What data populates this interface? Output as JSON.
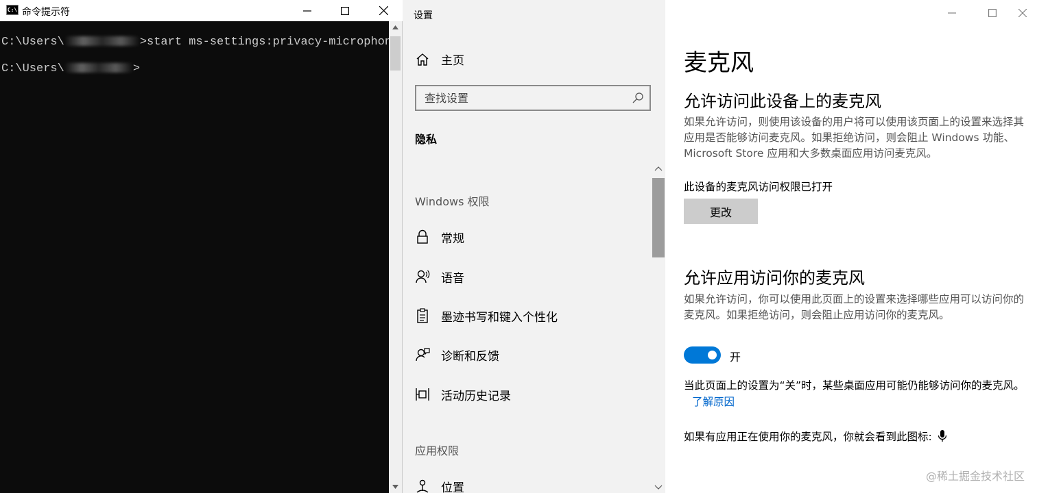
{
  "cmd": {
    "title": "命令提示符",
    "icon": "C:\\",
    "line1_prefix": "C:\\Users\\",
    "line1_suffix": ">start ms-settings:privacy-microphone",
    "line2_prefix": "C:\\Users\\",
    "line2_suffix": ">"
  },
  "settings": {
    "title": "设置",
    "home_label": "主页",
    "search_placeholder": "查找设置",
    "section": "隐私",
    "group_windows": "Windows 权限",
    "group_apps": "应用权限",
    "nav_items": [
      {
        "label": "常规",
        "icon": "lock-icon"
      },
      {
        "label": "语音",
        "icon": "speech-icon"
      },
      {
        "label": "墨迹书写和键入个性化",
        "icon": "clipboard-icon"
      },
      {
        "label": "诊断和反馈",
        "icon": "feedback-icon"
      },
      {
        "label": "活动历史记录",
        "icon": "timeline-icon"
      },
      {
        "label": "位置",
        "icon": "location-icon"
      }
    ]
  },
  "content": {
    "page_title": "麦克风",
    "device_heading": "允许访问此设备上的麦克风",
    "device_desc": "如果允许访问，则使用该设备的用户将可以使用该页面上的设置来选择其应用是否能够访问麦克风。如果拒绝访问，则会阻止 Windows 功能、Microsoft Store 应用和大多数桌面应用访问麦克风。",
    "device_status": "此设备的麦克风访问权限已打开",
    "change_button": "更改",
    "apps_heading": "允许应用访问你的麦克风",
    "apps_desc": "如果允许访问，你可以使用此页面上的设置来选择哪些应用可以访问你的麦克风。如果拒绝访问，则会阻止应用访问你的麦克风。",
    "toggle_label": "开",
    "toggle_on": true,
    "note": "当此页面上的设置为“关”时，某些桌面应用可能仍能够访问你的麦克风。",
    "note_link": "了解原因",
    "mic_hint": "如果有应用正在使用你的麦克风，你就会看到此图标:",
    "watermark": "@稀土掘金技术社区"
  },
  "colors": {
    "accent": "#0078d7",
    "link": "#0066cc",
    "nav_bg": "#f2f2f2",
    "cmd_bg": "#0c0c0c"
  }
}
